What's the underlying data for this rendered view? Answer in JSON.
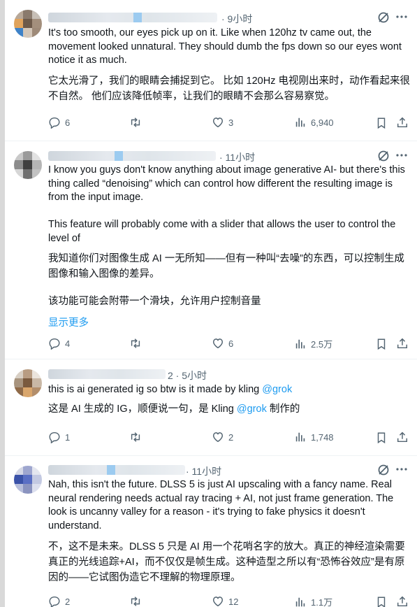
{
  "tweets": [
    {
      "time": "· 9小时",
      "body_en": [
        "It's too smooth, our eyes pick up on it.  Like when 120hz tv came out, the movement looked unnatural.  They should dumb the fps down so our eyes wont notice it as much."
      ],
      "body_zh": "它太光滑了，我们的眼睛会捕捉到它。 比如 120Hz 电视刚出来时，动作看起来很不自然。 他们应该降低帧率，让我们的眼睛不会那么容易察觉。",
      "replies": "6",
      "retweets": "",
      "likes": "3",
      "views": "6,940"
    },
    {
      "time": "· 11小时",
      "body_en": [
        "I know you guys don't know anything about image generative AI- but there's this thing called “denoising” which can control how different the resulting image is from the input image.",
        "",
        "This feature will probably come with a slider that allows the user to control the level of"
      ],
      "body_zh_1": "我知道你们对图像生成 AI 一无所知——但有一种叫“去噪”的东西，可以控制生成图像和输入图像的差异。",
      "body_zh_2": "该功能可能会附带一个滑块，允许用户控制音量",
      "show_more": "显示更多",
      "replies": "4",
      "retweets": "",
      "likes": "6",
      "views": "2.5万"
    },
    {
      "time": "2 · 5小时",
      "body_en_prefix": "this is ai generated ig so btw is it made by kling ",
      "mention_en": "@grok",
      "body_zh_prefix": "这是 AI 生成的 IG，顺便说一句，是 Kling ",
      "mention_zh": "@grok",
      "body_zh_suffix": " 制作的",
      "replies": "1",
      "retweets": "",
      "likes": "2",
      "views": "1,748"
    },
    {
      "time": "· 11小时",
      "body_en": [
        "Nah, this isn't the future. DLSS 5 is just AI upscaling with a fancy name. Real neural rendering needs actual ray tracing + AI, not just frame generation. The look is uncanny valley for a reason - it's trying to fake physics it doesn't understand."
      ],
      "body_zh": "不，这不是未来。DLSS 5 只是 AI 用一个花哨名字的放大。真正的神经渲染需要真正的光线追踪+AI，而不仅仅是帧生成。这种造型之所以有“恐怖谷效应”是有原因的——它试图伪造它不理解的物理原理。",
      "replies": "2",
      "retweets": "",
      "likes": "12",
      "views": "1.1万"
    }
  ],
  "colors": {
    "text": "#0f1419",
    "muted": "#536471",
    "link": "#1d9bf0",
    "divider": "#eff3f4"
  },
  "icons": [
    "reply-icon",
    "retweet-icon",
    "like-icon",
    "views-icon",
    "bookmark-icon",
    "share-icon",
    "grok-icon",
    "more-icon"
  ]
}
